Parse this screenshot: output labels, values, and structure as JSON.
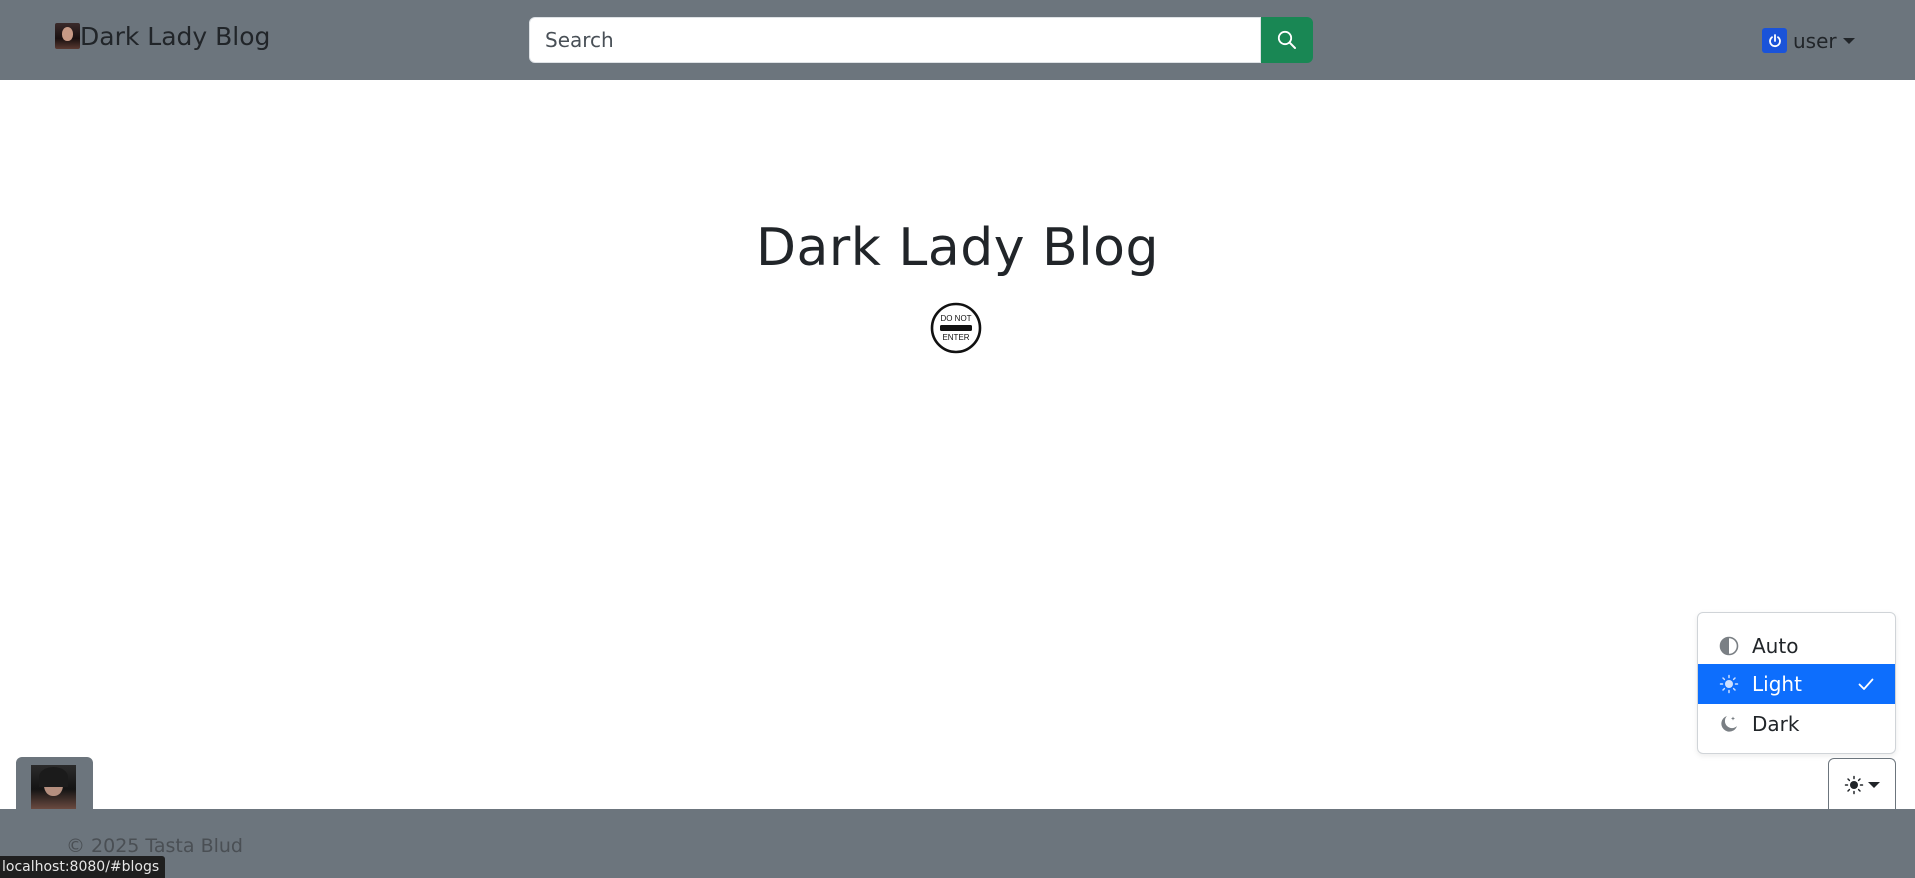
{
  "navbar": {
    "brand_text": "Dark Lady Blog",
    "search": {
      "placeholder": "Search",
      "value": ""
    },
    "user_label": "user"
  },
  "main": {
    "title": "Dark Lady Blog",
    "sign_top": "DO NOT",
    "sign_bottom": "ENTER"
  },
  "theme_menu": {
    "items": [
      {
        "label": "Auto",
        "icon": "circle-half-icon"
      },
      {
        "label": "Light",
        "icon": "sun-icon",
        "selected": true
      },
      {
        "label": "Dark",
        "icon": "moon-stars-icon"
      }
    ],
    "active_color": "#0d6efd"
  },
  "footer": {
    "copyright": "© 2025 Tasta Blud"
  },
  "status_bar": {
    "url": "localhost:8080/#blogs"
  },
  "colors": {
    "navbar_bg": "#6c757d",
    "search_button": "#198754",
    "power_icon_bg": "#1a53d9"
  }
}
